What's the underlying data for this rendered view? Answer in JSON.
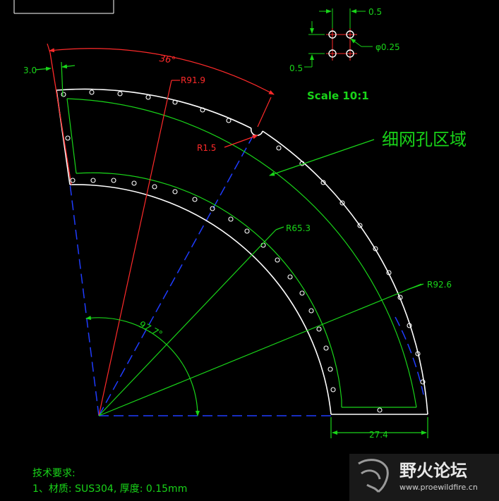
{
  "scale_label": "Scale 10:1",
  "region_label": "细网孔区域",
  "dimensions": {
    "margin_width": "3.0",
    "sector_angle": "36°",
    "outer_arc_radius": "R91.9",
    "notch_radius": "R1.5",
    "inner_radius": "R65.3",
    "outer_radius": "R92.6",
    "total_angle": "97.7°",
    "strip_width": "27.4",
    "hole_pitch_x": "0.5",
    "hole_pitch_y": "0.5",
    "hole_diameter": "φ0.25"
  },
  "notes": {
    "heading": "技术要求:",
    "line1": "1、材质: SUS304, 厚度: 0.15mm"
  },
  "watermark": {
    "site_name": "野火论坛",
    "url": "www.proewildfire.cn"
  },
  "colors": {
    "background": "#000000",
    "outline": "#ffffff",
    "dimension_green": "#19d419",
    "dimension_red": "#ff2a2a",
    "centerline_blue": "#1f3cff"
  }
}
